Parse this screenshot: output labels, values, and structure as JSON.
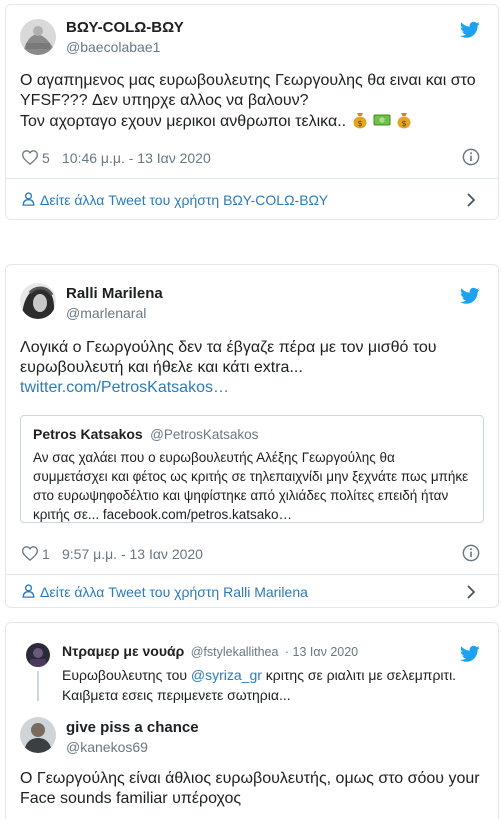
{
  "tweet1": {
    "display_name": "ΒΩΥ-COLΩ-ΒΩΥ",
    "handle": "@baecolabae1",
    "text_lines": [
      "Ο αγαπημενος μας ευρωβουλευτης Γεωργουλης θα ειναι και στο",
      "YFSF??? Δεν υπηρχε αλλος να βαλουν?",
      "Τον αχορταγο εχουν μερικοι ανθρωποι τελικα.."
    ],
    "emoji_icons": [
      "money-bag-icon",
      "banknote-icon",
      "money-bag-icon"
    ],
    "likes": "5",
    "timestamp": "10:46 μ.μ. - 13 Ιαν 2020",
    "more_link": "Δείτε άλλα Tweet του χρήστη ΒΩΥ-COLΩ-ΒΩΥ"
  },
  "tweet2": {
    "display_name": "Ralli Marilena",
    "handle": "@marlenaral",
    "text_lines": [
      "Λογικά ο Γεωργούλης δεν τα έβγαζε πέρα με τον μισθό του",
      "ευρωβουλευτή και ήθελε και κάτι extra..."
    ],
    "link": "twitter.com/PetrosKatsakos…",
    "quote": {
      "display_name": "Petros Katsakos",
      "handle": "@PetrosKatsakos",
      "text_lines": [
        "Αν σας χαλάει που ο ευρωβουλευτής Αλέξης Γεωργούλης θα",
        "συμμετάσχει και φέτος ως κριτής σε τηλεπαιχνίδι μην ξεχνάτε πως μπήκε",
        "στο ευρωψηφοδέλτιο και ψηφίστηκε από χιλιάδες πολίτες επειδή ήταν",
        "κριτής σε... facebook.com/petros.katsako…"
      ]
    },
    "likes": "1",
    "timestamp": "9:57 μ.μ. - 13 Ιαν 2020",
    "more_link": "Δείτε άλλα Tweet του χρήστη Ralli Marilena"
  },
  "tweet3": {
    "parent": {
      "display_name": "Ντραμερ με νουάρ",
      "handle": "@fstylekallithea",
      "date": "· 13 Ιαν 2020",
      "line1_prefix": "Ευρωβουλευτης του ",
      "line1_mention": "@syriza_gr",
      "line1_suffix": " κριτης σε ριαλιτι με σελεμπριτι.",
      "line2": "Καιβμετα εσεις περιμενετε σωτηρια..."
    },
    "display_name": "give piss a chance",
    "handle": "@kanekos69",
    "text_lines": [
      "Ο Γεωργούλης είναι άθλιος ευρωβουλευτής, ομως στο σόου your",
      "Face sounds familiar υπέροχος"
    ]
  },
  "colors": {
    "twitter_blue": "#1da1f2",
    "link_blue": "#2b7bb9",
    "muted": "#697882",
    "border": "#e1e8ed"
  }
}
